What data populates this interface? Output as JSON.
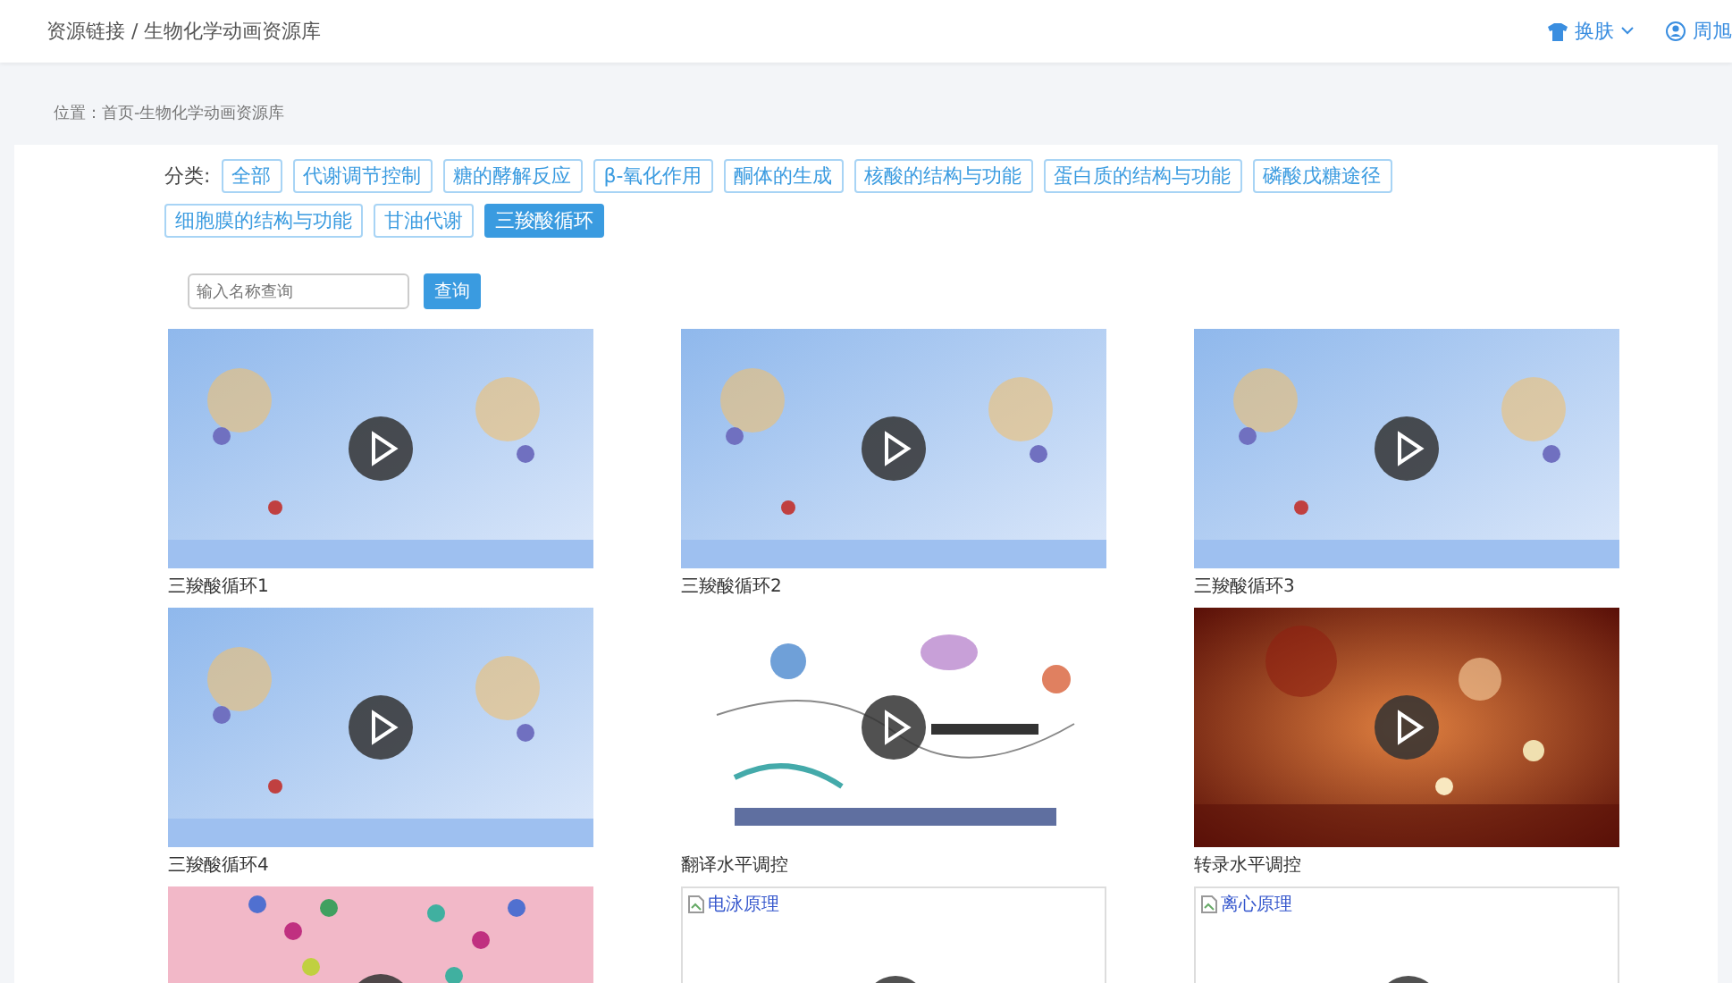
{
  "header": {
    "breadcrumb": "资源链接 / 生物化学动画资源库",
    "skin": "换肤",
    "user": "周旭"
  },
  "location": "位置：首页-生物化学动画资源库",
  "filter": {
    "label": "分类:",
    "categories": [
      {
        "label": "全部",
        "selected": false
      },
      {
        "label": "代谢调节控制",
        "selected": false
      },
      {
        "label": "糖的酵解反应",
        "selected": false
      },
      {
        "label": "β-氧化作用",
        "selected": false
      },
      {
        "label": "酮体的生成",
        "selected": false
      },
      {
        "label": "核酸的结构与功能",
        "selected": false
      },
      {
        "label": "蛋白质的结构与功能",
        "selected": false
      },
      {
        "label": "磷酸戊糖途径",
        "selected": false
      },
      {
        "label": "细胞膜的结构与功能",
        "selected": false
      },
      {
        "label": "甘油代谢",
        "selected": false
      },
      {
        "label": "三羧酸循环",
        "selected": true
      }
    ]
  },
  "search": {
    "placeholder": "输入名称查询",
    "button": "查询"
  },
  "videos": [
    {
      "kind": "blue",
      "title": "三羧酸循环1"
    },
    {
      "kind": "blue",
      "title": "三羧酸循环2"
    },
    {
      "kind": "blue",
      "title": "三羧酸循环3"
    },
    {
      "kind": "blue",
      "title": "三羧酸循环4"
    },
    {
      "kind": "diagram",
      "title": "翻译水平调控"
    },
    {
      "kind": "red",
      "title": "转录水平调控"
    },
    {
      "kind": "pink"
    },
    {
      "kind": "broken",
      "alt": "电泳原理"
    },
    {
      "kind": "broken",
      "alt": "离心原理"
    }
  ]
}
